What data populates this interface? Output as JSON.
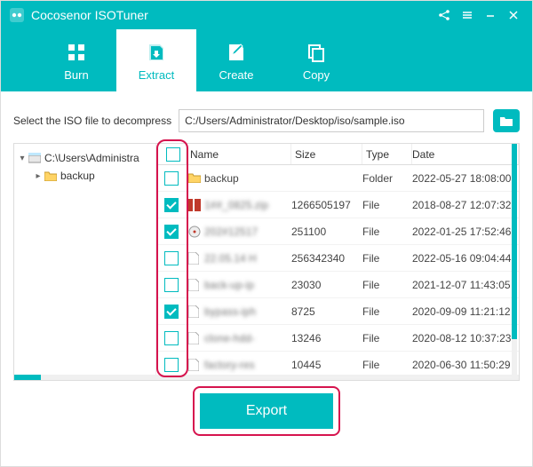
{
  "app": {
    "title": "Cocosenor ISOTuner"
  },
  "toolbar": {
    "burn": "Burn",
    "extract": "Extract",
    "create": "Create",
    "copy": "Copy"
  },
  "path": {
    "label": "Select the ISO file to decompress",
    "value": "C:/Users/Administrator/Desktop/iso/sample.iso"
  },
  "tree": {
    "root": "C:\\Users\\Administra",
    "child": "backup"
  },
  "table": {
    "headers": {
      "name": "Name",
      "size": "Size",
      "type": "Type",
      "date": "Date"
    },
    "rows": [
      {
        "checked": false,
        "icon": "folder",
        "name": "backup",
        "blur": false,
        "size": "",
        "type": "Folder",
        "date": "2022-05-27 18:08:00"
      },
      {
        "checked": true,
        "icon": "zip",
        "name": "1##_0825.zip",
        "blur": true,
        "size": "1266505197",
        "type": "File",
        "date": "2018-08-27 12:07:32"
      },
      {
        "checked": true,
        "icon": "disc",
        "name": "202#12517",
        "blur": true,
        "size": "251100",
        "type": "File",
        "date": "2022-01-25 17:52:46"
      },
      {
        "checked": false,
        "icon": "file",
        "name": "22.05.14 H",
        "blur": true,
        "size": "256342340",
        "type": "File",
        "date": "2022-05-16 09:04:44"
      },
      {
        "checked": false,
        "icon": "file",
        "name": "back-up-ip",
        "blur": true,
        "size": "23030",
        "type": "File",
        "date": "2021-12-07 11:43:05"
      },
      {
        "checked": true,
        "icon": "file",
        "name": "bypass-iph",
        "blur": true,
        "size": "8725",
        "type": "File",
        "date": "2020-09-09 11:21:12"
      },
      {
        "checked": false,
        "icon": "file",
        "name": "clone-hdd-",
        "blur": true,
        "size": "13246",
        "type": "File",
        "date": "2020-08-12 10:37:23"
      },
      {
        "checked": false,
        "icon": "file",
        "name": "factory-res",
        "blur": true,
        "size": "10445",
        "type": "File",
        "date": "2020-06-30 11:50:29"
      }
    ]
  },
  "footer": {
    "export": "Export"
  }
}
